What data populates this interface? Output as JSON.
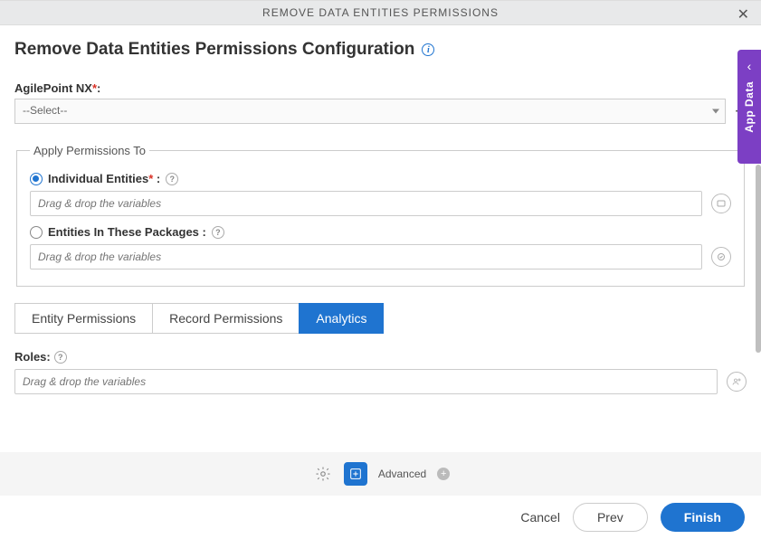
{
  "titlebar": "REMOVE DATA ENTITIES PERMISSIONS",
  "page_title": "Remove Data Entities Permissions Configuration",
  "fields": {
    "nx_label": "AgilePoint NX",
    "nx_select_placeholder": "--Select--"
  },
  "fieldset": {
    "legend": "Apply Permissions To",
    "option1_label": "Individual Entities",
    "option1_suffix": " :",
    "option2_label": "Entities In These Packages :",
    "drag_placeholder": "Drag & drop the variables"
  },
  "tabs": [
    "Entity Permissions",
    "Record Permissions",
    "Analytics"
  ],
  "roles_label": "Roles:",
  "toolbar": {
    "advanced": "Advanced"
  },
  "footer": {
    "cancel": "Cancel",
    "prev": "Prev",
    "finish": "Finish"
  },
  "side_panel": {
    "label": "App Data"
  }
}
